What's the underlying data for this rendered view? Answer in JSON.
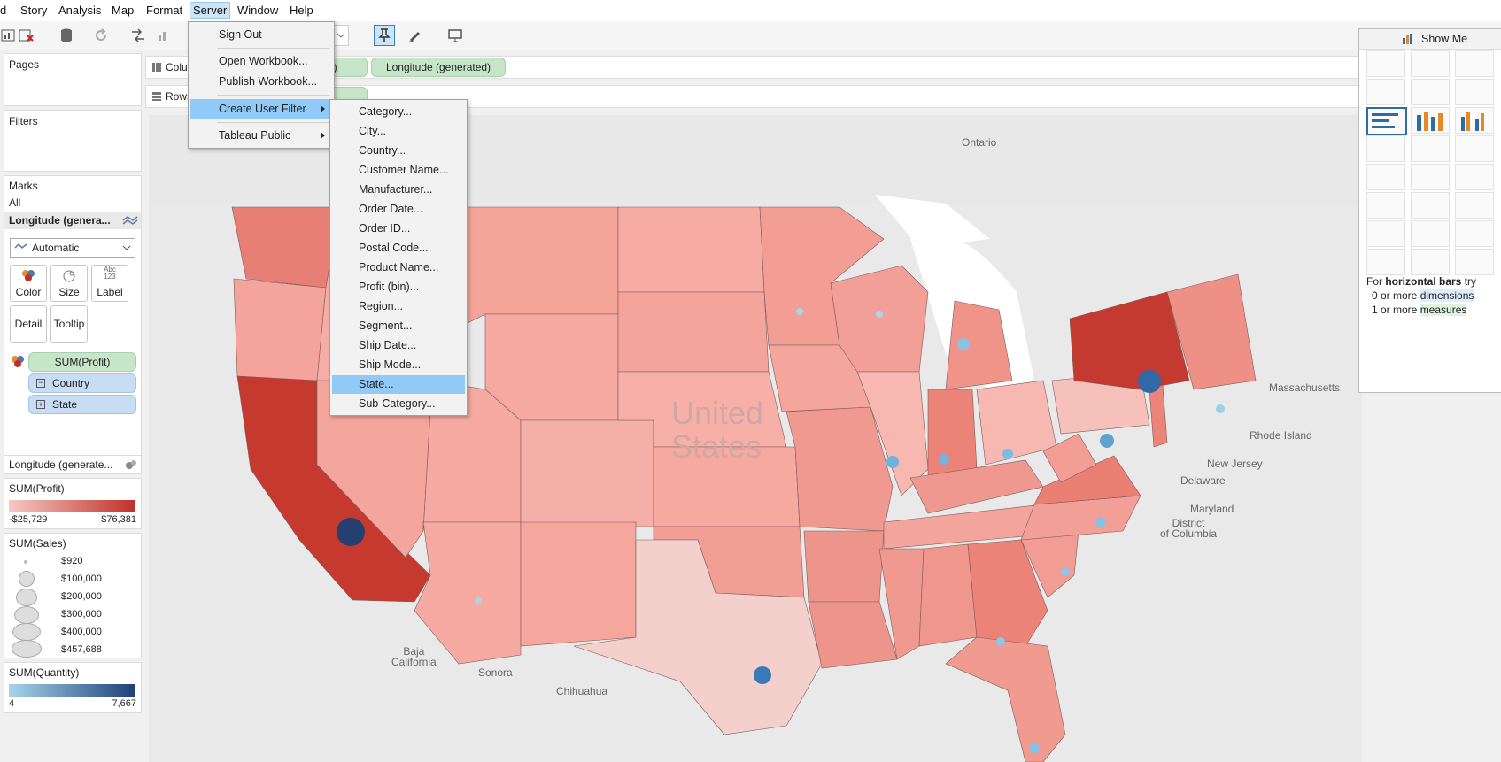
{
  "menubar": {
    "items": [
      "d",
      "Story",
      "Analysis",
      "Map",
      "Format",
      "Server",
      "Window",
      "Help"
    ],
    "active": "Server"
  },
  "shelves": {
    "columns_label": "Colu",
    "columns_pill_partial": "d)",
    "columns_pill": "Longitude (generated)",
    "rows_label": "Rows"
  },
  "left": {
    "pages_title": "Pages",
    "filters_title": "Filters",
    "marks_title": "Marks",
    "marks_all": "All",
    "marks_card_title": "Longitude (genera...",
    "mark_type": "Automatic",
    "buttons": {
      "color": "Color",
      "size": "Size",
      "label": "Label",
      "label_glyph": "Abc\n123",
      "detail": "Detail",
      "tooltip": "Tooltip"
    },
    "fields": [
      "SUM(Profit)",
      "Country",
      "State"
    ],
    "layer2": "Longitude (generate...",
    "profit_legend": {
      "title": "SUM(Profit)",
      "min": "-$25,729",
      "max": "$76,381",
      "color_low": "#f7c9c3",
      "color_high": "#c0302a"
    },
    "sales_legend": {
      "title": "SUM(Sales)",
      "items": [
        "$920",
        "$100,000",
        "$200,000",
        "$300,000",
        "$400,000",
        "$457,688"
      ]
    },
    "quantity_legend": {
      "title": "SUM(Quantity)",
      "min": "4",
      "max": "7,667",
      "color_low": "#a5d5ea",
      "color_high": "#1f3f78"
    }
  },
  "server_menu": {
    "items": [
      "Sign Out",
      "Open Workbook...",
      "Publish Workbook...",
      "Create User Filter",
      "Tableau Public"
    ],
    "highlighted": "Create User Filter"
  },
  "user_filter_menu": {
    "items": [
      "Category...",
      "City...",
      "Country...",
      "Customer Name...",
      "Manufacturer...",
      "Order Date...",
      "Order ID...",
      "Postal Code...",
      "Product Name...",
      "Profit (bin)...",
      "Region...",
      "Segment...",
      "Ship Date...",
      "Ship Mode...",
      "State...",
      "Sub-Category..."
    ],
    "highlighted": "State..."
  },
  "map": {
    "labels": [
      "Ontario",
      "Massachusetts",
      "Rhode Island",
      "New Jersey",
      "Delaware",
      "Maryland",
      "District\nof Columbia",
      "Baja\nCalifornia",
      "Sonora",
      "Chihuahua"
    ],
    "watermark": "United\nStates"
  },
  "show_me": {
    "title": "Show Me",
    "hint_prefix": "For ",
    "hint_bold": "horizontal bars",
    "hint_suffix": " try",
    "line1_prefix": "0 or more ",
    "line1_term": "dimensions",
    "line2_prefix": "1 or more ",
    "line2_term": "measures"
  }
}
